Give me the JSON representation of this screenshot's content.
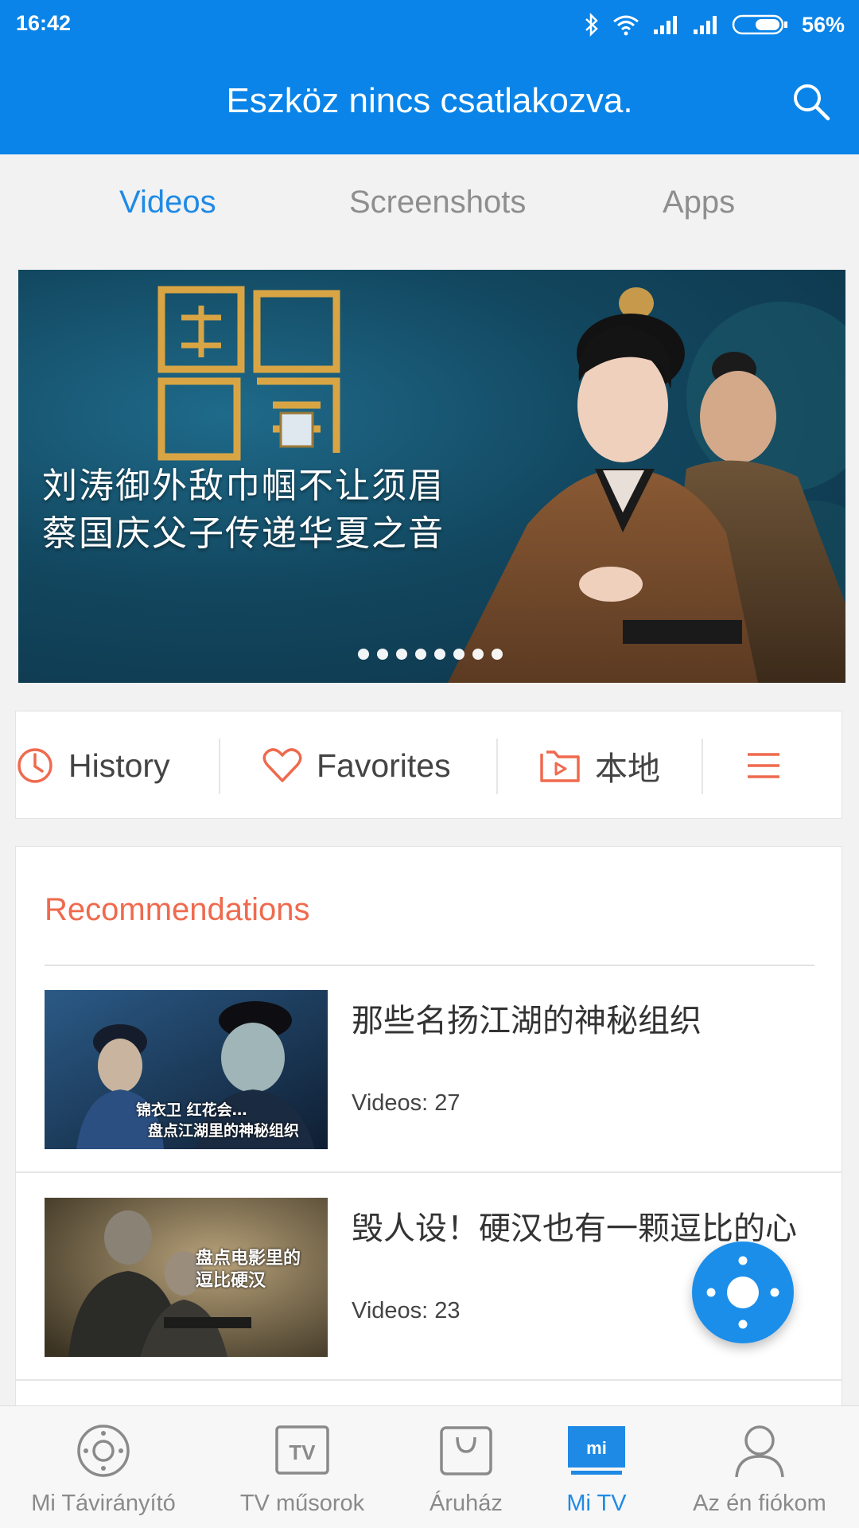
{
  "status_bar": {
    "time": "16:42",
    "battery_percent": "56%",
    "icons": [
      "bluetooth-icon",
      "wifi-icon",
      "signal-icon",
      "signal-icon",
      "battery-icon"
    ]
  },
  "header": {
    "title": "Eszköz nincs csatlakozva.",
    "search_icon": "search-icon"
  },
  "tabs": [
    {
      "label": "Videos",
      "active": true
    },
    {
      "label": "Screenshots",
      "active": false
    },
    {
      "label": "Apps",
      "active": false
    }
  ],
  "banner": {
    "caption_line1": "刘涛御外敌巾帼不让须眉",
    "caption_line2": "蔡国庆父子传递华夏之音",
    "slide_count": 8
  },
  "quick_actions": [
    {
      "label": "History",
      "icon": "clock-icon"
    },
    {
      "label": "Favorites",
      "icon": "heart-icon"
    },
    {
      "label": "本地",
      "icon": "folder-play-icon"
    },
    {
      "label": "",
      "icon": "menu-icon"
    }
  ],
  "recommendations": {
    "title": "Recommendations",
    "items": [
      {
        "name": "那些名扬江湖的神秘组织",
        "count": "Videos: 27",
        "thumb_text1": "锦衣卫 红花会…",
        "thumb_text2": "盘点江湖里的神秘组织"
      },
      {
        "name": "毁人设！硬汉也有一颗逗比的心",
        "count": "Videos: 23",
        "thumb_text1": "盘点电影里的",
        "thumb_text2": "逗比硬汉"
      }
    ]
  },
  "fab_icon": "remote-control-icon",
  "bottom_nav": [
    {
      "label": "Mi Távirányító",
      "icon": "remote-icon",
      "active": false
    },
    {
      "label": "TV műsorok",
      "icon": "tv-icon",
      "active": false
    },
    {
      "label": "Áruház",
      "icon": "store-icon",
      "active": false
    },
    {
      "label": "Mi TV",
      "icon": "mi-tv-icon",
      "active": true
    },
    {
      "label": "Az én fiókom",
      "icon": "person-icon",
      "active": false
    }
  ],
  "colors": {
    "primary": "#0a84e8",
    "accent_orange": "#ef6a4e",
    "active_blue": "#1f8ae6"
  }
}
